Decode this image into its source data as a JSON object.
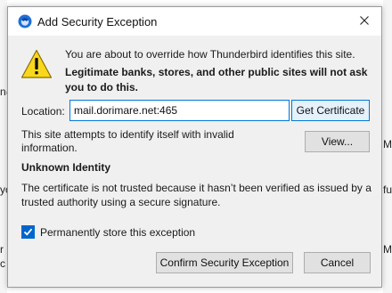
{
  "window": {
    "title": "Add Security Exception"
  },
  "message": {
    "intro": "You are about to override how Thunderbird identifies this site.",
    "warning": "Legitimate banks, stores, and other public sites will not ask you to do this."
  },
  "location": {
    "label": "Location:",
    "value": "mail.dorimare.net:465"
  },
  "buttons": {
    "get_certificate": "Get Certificate",
    "view": "View...",
    "confirm": "Confirm Security Exception",
    "cancel": "Cancel"
  },
  "status": {
    "site_text": "This site attempts to identify itself with invalid information.",
    "heading": "Unknown Identity",
    "detail": "The certificate is not trusted because it hasn’t been verified as issued by a trusted authority using a secure signature."
  },
  "options": {
    "permanent_label": "Permanently store this exception",
    "permanent_checked": true
  },
  "background": {
    "frag_left_1": "n@",
    "frag_left_2": "yc",
    "frag_left_3": "r",
    "frag_left_4": "c",
    "frag_right_1": "M",
    "frag_right_2": "fu",
    "frag_right_3": "M"
  },
  "colors": {
    "accent": "#0078d7",
    "checkbox": "#0066cc",
    "dialog_bg": "#f0f0f0",
    "warning_yellow": "#f9d71c"
  },
  "icons": {
    "app": "thunderbird-icon",
    "warning": "warning-triangle-icon",
    "close": "close-icon",
    "check": "checkmark-icon"
  }
}
